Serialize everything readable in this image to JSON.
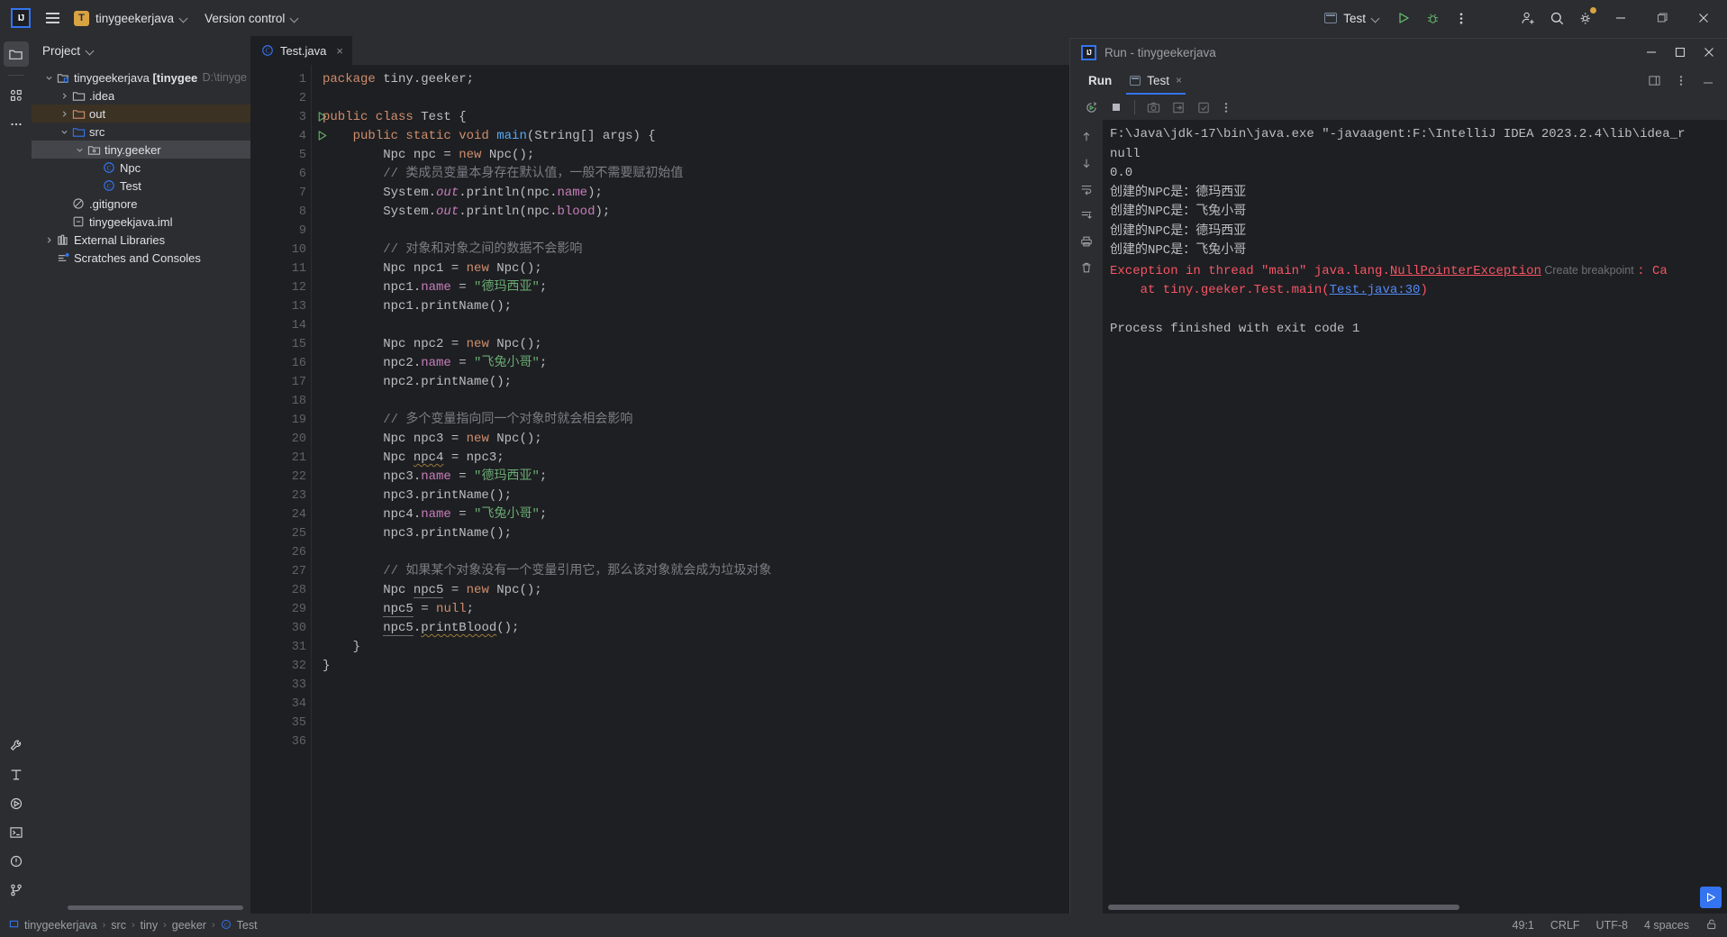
{
  "titlebar": {
    "logo_alt": "IntelliJ IDEA",
    "menu_label": "Main Menu",
    "project_initial": "T",
    "project_name": "tinygeekerjava",
    "version_control": "Version control",
    "run_config": "Test",
    "run_label": "Run",
    "debug_label": "Debug",
    "more_label": "More Actions",
    "account_label": "Account",
    "search_label": "Search Everywhere",
    "settings_label": "Settings",
    "minimize_label": "Minimize",
    "maximize_label": "Maximize",
    "close_label": "Close"
  },
  "toolstrip": {
    "project_label": "Project",
    "structure_label": "Structure",
    "more_label": "More Tool Windows",
    "bottom_items": [
      "Build",
      "Structure",
      "Services",
      "Terminal",
      "Problems",
      "Version Control"
    ]
  },
  "project_panel": {
    "title": "Project",
    "tree": [
      {
        "label": "tinygeekerjava [tinygeekjava]",
        "path": "D:\\tinyge",
        "icon": "module-icon",
        "arrow": "down",
        "indent": 0,
        "bold": true,
        "state": "normal"
      },
      {
        "label": ".idea",
        "icon": "folder-icon",
        "arrow": "right",
        "indent": 1,
        "state": "normal"
      },
      {
        "label": "out",
        "icon": "folder-orange-icon",
        "arrow": "right",
        "indent": 1,
        "state": "out"
      },
      {
        "label": "src",
        "icon": "folder-blue-icon",
        "arrow": "down",
        "indent": 1,
        "state": "normal"
      },
      {
        "label": "tiny.geeker",
        "icon": "package-icon",
        "arrow": "down",
        "indent": 2,
        "state": "selected"
      },
      {
        "label": "Npc",
        "icon": "class-icon",
        "arrow": "none",
        "indent": 3,
        "state": "normal"
      },
      {
        "label": "Test",
        "icon": "class-icon",
        "arrow": "none",
        "indent": 3,
        "state": "normal"
      },
      {
        "label": ".gitignore",
        "icon": "gitignore-icon",
        "arrow": "none",
        "indent": 1,
        "state": "normal"
      },
      {
        "label": "tinygeekjava.iml",
        "icon": "iml-icon",
        "arrow": "none",
        "indent": 1,
        "state": "normal"
      },
      {
        "label": "External Libraries",
        "icon": "library-icon",
        "arrow": "right",
        "indent": 0,
        "state": "normal"
      },
      {
        "label": "Scratches and Consoles",
        "icon": "scratches-icon",
        "arrow": "none",
        "indent": 0,
        "state": "normal"
      }
    ]
  },
  "editor": {
    "tab_label": "Test.java",
    "tab_close": "×",
    "options_label": "Editor Options",
    "run_line_markers": [
      3,
      4
    ],
    "lines": [
      {
        "n": 1,
        "tokens": [
          {
            "t": "package ",
            "c": "kw"
          },
          {
            "t": "tiny.geeker;",
            "c": "pln"
          }
        ]
      },
      {
        "n": 2,
        "tokens": []
      },
      {
        "n": 3,
        "tokens": [
          {
            "t": "public class ",
            "c": "kw"
          },
          {
            "t": "Test {",
            "c": "pln"
          }
        ]
      },
      {
        "n": 4,
        "tokens": [
          {
            "t": "    ",
            "c": "pln"
          },
          {
            "t": "public static void ",
            "c": "kw"
          },
          {
            "t": "main",
            "c": "mth"
          },
          {
            "t": "(String[] args) {",
            "c": "pln"
          }
        ]
      },
      {
        "n": 5,
        "tokens": [
          {
            "t": "        Npc npc = ",
            "c": "pln"
          },
          {
            "t": "new ",
            "c": "kw"
          },
          {
            "t": "Npc();",
            "c": "pln"
          }
        ]
      },
      {
        "n": 6,
        "tokens": [
          {
            "t": "        // 类成员变量本身存在默认值，一般不需要赋初始值",
            "c": "cmt"
          }
        ]
      },
      {
        "n": 7,
        "tokens": [
          {
            "t": "        System.",
            "c": "pln"
          },
          {
            "t": "out",
            "c": "stc"
          },
          {
            "t": ".println(npc.",
            "c": "pln"
          },
          {
            "t": "name",
            "c": "fld"
          },
          {
            "t": ");",
            "c": "pln"
          }
        ]
      },
      {
        "n": 8,
        "tokens": [
          {
            "t": "        System.",
            "c": "pln"
          },
          {
            "t": "out",
            "c": "stc"
          },
          {
            "t": ".println(npc.",
            "c": "pln"
          },
          {
            "t": "blood",
            "c": "fld"
          },
          {
            "t": ");",
            "c": "pln"
          }
        ]
      },
      {
        "n": 9,
        "tokens": []
      },
      {
        "n": 10,
        "tokens": [
          {
            "t": "        // 对象和对象之间的数据不会影响",
            "c": "cmt"
          }
        ]
      },
      {
        "n": 11,
        "tokens": [
          {
            "t": "        Npc npc1 = ",
            "c": "pln"
          },
          {
            "t": "new ",
            "c": "kw"
          },
          {
            "t": "Npc();",
            "c": "pln"
          }
        ]
      },
      {
        "n": 12,
        "tokens": [
          {
            "t": "        npc1.",
            "c": "pln"
          },
          {
            "t": "name",
            "c": "fld"
          },
          {
            "t": " = ",
            "c": "pln"
          },
          {
            "t": "\"德玛西亚\"",
            "c": "str"
          },
          {
            "t": ";",
            "c": "pln"
          }
        ]
      },
      {
        "n": 13,
        "tokens": [
          {
            "t": "        npc1.printName();",
            "c": "pln"
          }
        ]
      },
      {
        "n": 14,
        "tokens": []
      },
      {
        "n": 15,
        "tokens": [
          {
            "t": "        Npc npc2 = ",
            "c": "pln"
          },
          {
            "t": "new ",
            "c": "kw"
          },
          {
            "t": "Npc();",
            "c": "pln"
          }
        ]
      },
      {
        "n": 16,
        "tokens": [
          {
            "t": "        npc2.",
            "c": "pln"
          },
          {
            "t": "name",
            "c": "fld"
          },
          {
            "t": " = ",
            "c": "pln"
          },
          {
            "t": "\"飞兔小哥\"",
            "c": "str"
          },
          {
            "t": ";",
            "c": "pln"
          }
        ]
      },
      {
        "n": 17,
        "tokens": [
          {
            "t": "        npc2.printName();",
            "c": "pln"
          }
        ]
      },
      {
        "n": 18,
        "tokens": []
      },
      {
        "n": 19,
        "tokens": [
          {
            "t": "        // 多个变量指向同一个对象时就会相会影响",
            "c": "cmt"
          }
        ]
      },
      {
        "n": 20,
        "tokens": [
          {
            "t": "        Npc npc3 = ",
            "c": "pln"
          },
          {
            "t": "new ",
            "c": "kw"
          },
          {
            "t": "Npc();",
            "c": "pln"
          }
        ]
      },
      {
        "n": 21,
        "tokens": [
          {
            "t": "        Npc ",
            "c": "pln"
          },
          {
            "t": "npc4",
            "c": "pln squig"
          },
          {
            "t": " = npc3;",
            "c": "pln"
          }
        ]
      },
      {
        "n": 22,
        "tokens": [
          {
            "t": "        npc3.",
            "c": "pln"
          },
          {
            "t": "name",
            "c": "fld"
          },
          {
            "t": " = ",
            "c": "pln"
          },
          {
            "t": "\"德玛西亚\"",
            "c": "str"
          },
          {
            "t": ";",
            "c": "pln"
          }
        ]
      },
      {
        "n": 23,
        "tokens": [
          {
            "t": "        npc3.printName();",
            "c": "pln"
          }
        ]
      },
      {
        "n": 24,
        "tokens": [
          {
            "t": "        npc4.",
            "c": "pln"
          },
          {
            "t": "name",
            "c": "fld"
          },
          {
            "t": " = ",
            "c": "pln"
          },
          {
            "t": "\"飞兔小哥\"",
            "c": "str"
          },
          {
            "t": ";",
            "c": "pln"
          }
        ]
      },
      {
        "n": 25,
        "tokens": [
          {
            "t": "        npc3.printName();",
            "c": "pln"
          }
        ]
      },
      {
        "n": 26,
        "tokens": []
      },
      {
        "n": 27,
        "tokens": [
          {
            "t": "        // 如果某个对象没有一个变量引用它，那么该对象就会成为垃圾对象",
            "c": "cmt"
          }
        ]
      },
      {
        "n": 28,
        "tokens": [
          {
            "t": "        Npc ",
            "c": "pln"
          },
          {
            "t": "npc5",
            "c": "pln idu"
          },
          {
            "t": " = ",
            "c": "pln"
          },
          {
            "t": "new ",
            "c": "kw"
          },
          {
            "t": "Npc();",
            "c": "pln"
          }
        ]
      },
      {
        "n": 29,
        "tokens": [
          {
            "t": "        ",
            "c": "pln"
          },
          {
            "t": "npc5",
            "c": "pln idu"
          },
          {
            "t": " = ",
            "c": "pln"
          },
          {
            "t": "null",
            "c": "kw"
          },
          {
            "t": ";",
            "c": "pln"
          }
        ]
      },
      {
        "n": 30,
        "tokens": [
          {
            "t": "        ",
            "c": "pln"
          },
          {
            "t": "npc5",
            "c": "pln idu"
          },
          {
            "t": ".",
            "c": "pln"
          },
          {
            "t": "printBlood",
            "c": "pln squig"
          },
          {
            "t": "();",
            "c": "pln"
          }
        ]
      },
      {
        "n": 31,
        "tokens": [
          {
            "t": "    }",
            "c": "pln"
          }
        ]
      },
      {
        "n": 32,
        "tokens": [
          {
            "t": "}",
            "c": "pln"
          }
        ]
      },
      {
        "n": 33,
        "tokens": []
      },
      {
        "n": 34,
        "tokens": []
      },
      {
        "n": 35,
        "tokens": []
      },
      {
        "n": 36,
        "tokens": []
      }
    ]
  },
  "run_panel": {
    "window_title": "Run - tinygeekerjava",
    "minimize_label": "Minimize",
    "maximize_label": "Maximize",
    "close_label": "Close",
    "tab_run": "Run",
    "tab_test": "Test",
    "tab_test_close": "×",
    "settings_label": "Layout Settings",
    "options_label": "More Options",
    "hide_label": "Hide",
    "toolbar": [
      "rerun-icon",
      "stop-icon",
      "camera-icon",
      "export-icon",
      "soft-wrap-icon",
      "more-icon"
    ],
    "side_actions": [
      "up-icon",
      "down-icon",
      "wrap-icon",
      "scroll-end-icon",
      "print-icon",
      "trash-icon"
    ],
    "console": [
      {
        "text": "F:\\Java\\jdk-17\\bin\\java.exe \"-javaagent:F:\\IntelliJ IDEA 2023.2.4\\lib\\idea_r",
        "cls": "pln"
      },
      {
        "text": "null",
        "cls": "pln"
      },
      {
        "text": "0.0",
        "cls": "pln"
      },
      {
        "text": "创建的NPC是：德玛西亚",
        "cls": "pln"
      },
      {
        "text": "创建的NPC是：飞兔小哥",
        "cls": "pln"
      },
      {
        "text": "创建的NPC是：德玛西亚",
        "cls": "pln"
      },
      {
        "text": "创建的NPC是：飞兔小哥",
        "cls": "pln"
      }
    ],
    "exception_prefix": "Exception in thread \"main\" java.lang.",
    "exception_link": "NullPointerException",
    "create_breakpoint": "Create breakpoint",
    "exception_suffix": ": Ca",
    "stack_prefix": "    at tiny.geeker.Test.main(",
    "stack_link": "Test.java:30",
    "stack_suffix": ")",
    "process_finished": "Process finished with exit code 1"
  },
  "status_bar": {
    "breadcrumb": [
      "tinygeekerjava",
      "src",
      "tiny",
      "geeker",
      "Test"
    ],
    "caret": "49:1",
    "line_sep": "CRLF",
    "encoding": "UTF-8",
    "indent": "4 spaces",
    "lock_label": "Lock/Unlock"
  },
  "colors": {
    "accent": "#3574f0",
    "project_chip": "#d9a343",
    "error": "#f75464",
    "string": "#6aab73",
    "keyword": "#cf8e6d",
    "comment": "#7a7e85",
    "field": "#c77dbb",
    "method": "#56a8f5",
    "bg": "#1e1f22",
    "panel": "#2b2d30"
  }
}
